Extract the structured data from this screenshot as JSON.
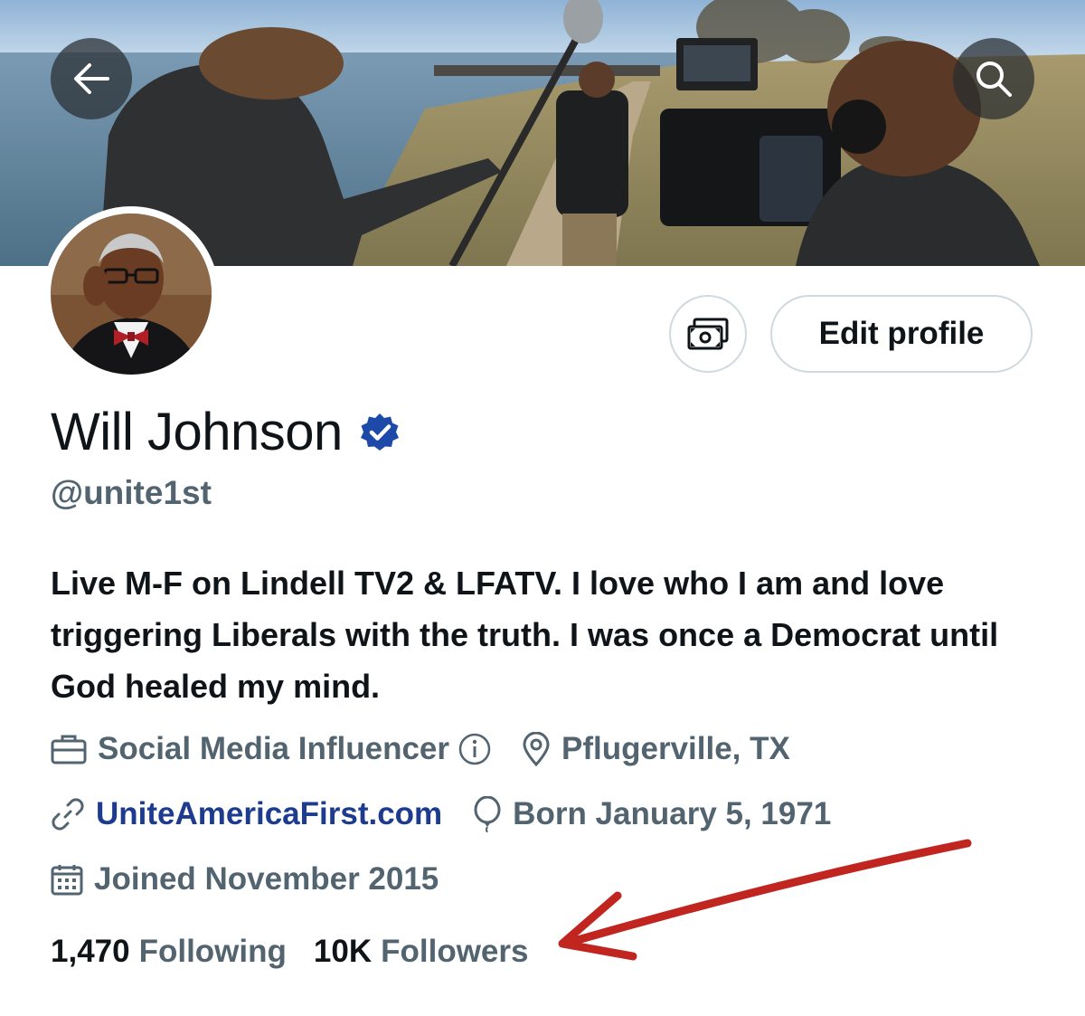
{
  "header": {
    "back_icon": "arrow-left-icon",
    "search_icon": "search-icon"
  },
  "profile": {
    "display_name": "Will Johnson",
    "verified_icon": "verified-badge-icon",
    "handle": "@unite1st",
    "edit_profile_label": "Edit profile",
    "tip_icon": "money-icon",
    "bio": "Live M-F on Lindell TV2 & LFATV. I love who I am and love triggering Liberals with the truth. I was once a Democrat until God healed my mind."
  },
  "meta": {
    "category": "Social Media Influencer",
    "category_icon": "briefcase-icon",
    "info_icon": "info-icon",
    "location": "Pflugerville, TX",
    "location_icon": "location-pin-icon",
    "website": "UniteAmericaFirst.com",
    "website_icon": "link-icon",
    "birthday": "Born January 5, 1971",
    "birthday_icon": "balloon-icon",
    "joined": "Joined November 2015",
    "joined_icon": "calendar-icon"
  },
  "stats": {
    "following_count": "1,470",
    "following_label": "Following",
    "followers_count": "10K",
    "followers_label": "Followers"
  },
  "colors": {
    "text_primary": "#0f1419",
    "text_secondary": "#536471",
    "verified_blue": "#1d4aa8",
    "link_blue": "#1d3c8f",
    "annotation_red": "#c0261f"
  }
}
